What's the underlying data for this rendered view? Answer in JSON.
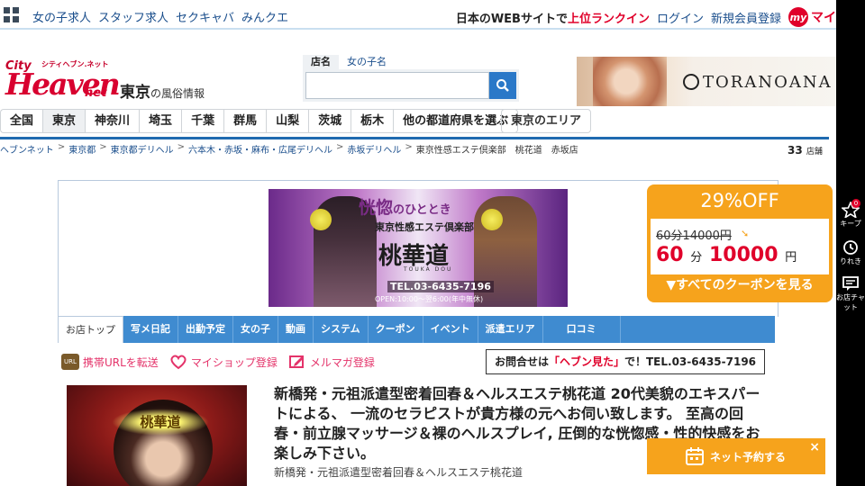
{
  "topbar": {
    "links": [
      "女の子求人",
      "スタッフ求人",
      "セクキャバ",
      "みんクエ"
    ],
    "rank_prefix": "日本のWEBサイトで",
    "rank_highlight": "上位ランクイン",
    "login": "ログイン",
    "register": "新規会員登録",
    "my_label": "マイ",
    "my_badge": "my"
  },
  "logo": {
    "city": "City",
    "tagline": "シティヘブン.ネット",
    "heaven": "Heaven",
    "net": "net"
  },
  "region": {
    "name": "東京",
    "suffix": "の風俗情報"
  },
  "search": {
    "tabs": [
      "店名",
      "女の子名"
    ],
    "placeholder": "",
    "button_icon": "search-icon"
  },
  "banner": {
    "text": "TORANOANA G"
  },
  "prefnav": {
    "items": [
      "全国",
      "東京",
      "神奈川",
      "埼玉",
      "千葉",
      "群馬",
      "山梨",
      "茨城",
      "栃木",
      "他の都道府県を選ぶ"
    ],
    "active": "東京",
    "area": "東京のエリア"
  },
  "breadcrumb": {
    "items": [
      "ヘブンネット",
      "東京都",
      "東京都デリヘル",
      "六本木・赤坂・麻布・広尾デリヘル",
      "赤坂デリヘル"
    ],
    "current": "東京性感エステ倶楽部　桃花道　赤坂店"
  },
  "shopcount": {
    "value": "33",
    "unit": "店舗"
  },
  "shopbanner": {
    "title": "恍惚",
    "title_tail": "のひととき",
    "sub": "東京性感エステ倶楽部",
    "name": "桃華道",
    "roman": "TOUKA DOU",
    "tel": "TEL.03-6435-7196",
    "hours": "OPEN:10:00～翌6:00(年中無休)"
  },
  "shoptabs": [
    "お店トップ",
    "写メ日記",
    "出勤予定",
    "女の子",
    "動画",
    "システム",
    "クーポン",
    "イベント",
    "派遣エリア",
    "口コミ"
  ],
  "coupon": {
    "discount": "29%OFF",
    "old_price": "60分14000円",
    "new_minutes": "60",
    "new_min_unit": "分",
    "new_price": "10000",
    "new_yen": "円",
    "link": "▼すべてのクーポンを見る"
  },
  "actions": [
    "携帯URLを転送",
    "マイショップ登録",
    "メルマガ登録"
  ],
  "contact": {
    "prefix": "お問合せは",
    "highlight": "「ヘブン見た」",
    "suffix": "で！TEL.03-6435-7196"
  },
  "thumb": {
    "seal": "桃華道"
  },
  "content": {
    "headline": "新橋発・元祖派遣型密着回春＆ヘルスエステ桃花道 20代美貌のエキスパートによる、 一流のセラピストが貴方様の元へお伺い致します。 至高の回春・前立腺マッサージ＆裸のヘルスプレイ, 圧倒的な恍惚感・性的快感をお楽しみ下さい。",
    "subhead": "新橋発・元祖派遣型密着回春＆ヘルスエステ桃花道"
  },
  "reserve": {
    "label": "ネット予約する",
    "close": "×"
  },
  "rail": {
    "keep": "キープ",
    "keep_badge": "0",
    "history": "りれき",
    "chat": "お店チャット"
  }
}
